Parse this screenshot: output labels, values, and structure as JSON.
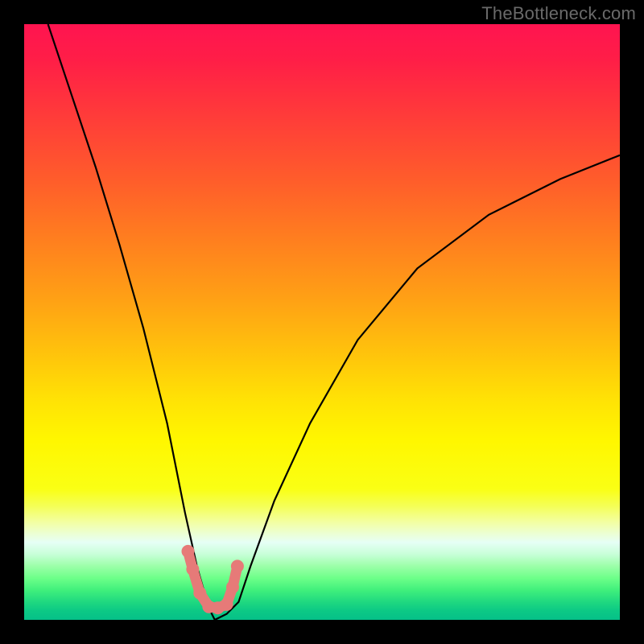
{
  "watermark": "TheBottleneck.com",
  "colors": {
    "border": "#000000",
    "curve": "#000000",
    "marker": "#e67a78"
  },
  "chart_data": {
    "type": "line",
    "title": "",
    "xlabel": "",
    "ylabel": "",
    "xlim": [
      0,
      100
    ],
    "ylim": [
      0,
      100
    ],
    "grid": false,
    "legend": false,
    "description": "Bottleneck/mismatch curve. Y is bottleneck percentage (lower = better), X is component balance position. The curve drops to ~0% at the optimal balance point (~x=32) and rises on both sides; left side is steeper than the right.",
    "series": [
      {
        "name": "bottleneck-curve",
        "x": [
          4,
          8,
          12,
          16,
          20,
          24,
          27,
          29,
          31,
          32,
          34,
          36,
          38,
          42,
          48,
          56,
          66,
          78,
          90,
          100
        ],
        "values": [
          100,
          88,
          76,
          63,
          49,
          33,
          18,
          9,
          2,
          0,
          1,
          3,
          9,
          20,
          33,
          47,
          59,
          68,
          74,
          78
        ]
      }
    ],
    "optimal_zone": {
      "name": "optimal-markers",
      "x": [
        27.5,
        28.3,
        29.5,
        31.0,
        32.5,
        34.0,
        35.0,
        35.8
      ],
      "values": [
        11.5,
        8.5,
        4.5,
        2.2,
        2.0,
        2.6,
        5.5,
        9.0
      ]
    }
  }
}
